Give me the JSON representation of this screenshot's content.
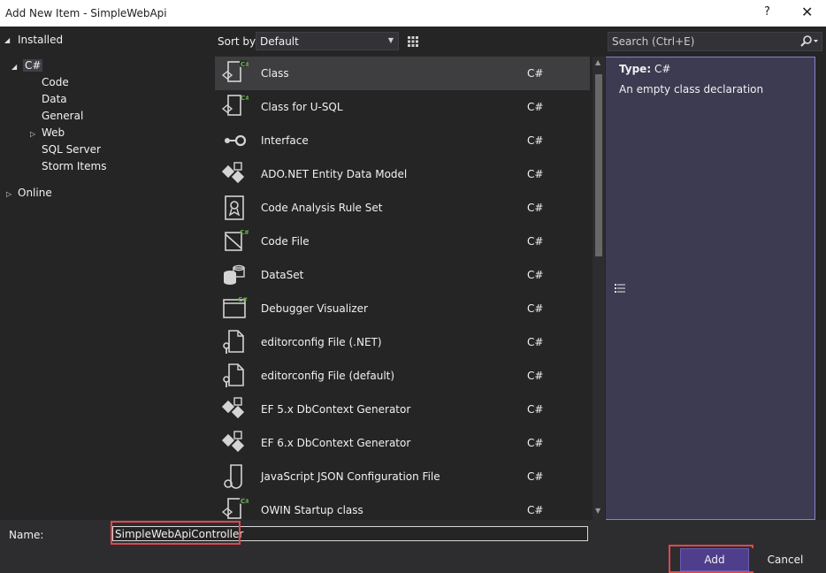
{
  "window": {
    "title": "Add New Item - SimpleWebApi",
    "help_label": "?",
    "close_label": "✕"
  },
  "toolbar": {
    "sort_label": "Sort by:",
    "sort_value": "Default",
    "search_placeholder": "Search (Ctrl+E)"
  },
  "tree": {
    "installed": "Installed",
    "csharp": "C#",
    "items": [
      "Code",
      "Data",
      "General",
      "Web",
      "SQL Server",
      "Storm Items"
    ],
    "online": "Online"
  },
  "templates": [
    {
      "name": "Class",
      "lang": "C#",
      "icon": "class-icon"
    },
    {
      "name": "Class for U-SQL",
      "lang": "C#",
      "icon": "class-usql-icon"
    },
    {
      "name": "Interface",
      "lang": "C#",
      "icon": "interface-icon"
    },
    {
      "name": "ADO.NET Entity Data Model",
      "lang": "C#",
      "icon": "entity-model-icon"
    },
    {
      "name": "Code Analysis Rule Set",
      "lang": "C#",
      "icon": "rule-set-icon"
    },
    {
      "name": "Code File",
      "lang": "C#",
      "icon": "code-file-icon"
    },
    {
      "name": "DataSet",
      "lang": "C#",
      "icon": "dataset-icon"
    },
    {
      "name": "Debugger Visualizer",
      "lang": "C#",
      "icon": "debugger-visualizer-icon"
    },
    {
      "name": "editorconfig File (.NET)",
      "lang": "C#",
      "icon": "editorconfig-icon"
    },
    {
      "name": "editorconfig File (default)",
      "lang": "C#",
      "icon": "editorconfig-icon"
    },
    {
      "name": "EF 5.x DbContext Generator",
      "lang": "C#",
      "icon": "ef-generator-icon"
    },
    {
      "name": "EF 6.x DbContext Generator",
      "lang": "C#",
      "icon": "ef-generator-icon"
    },
    {
      "name": "JavaScript JSON Configuration File",
      "lang": "C#",
      "icon": "json-config-icon"
    },
    {
      "name": "OWIN Startup class",
      "lang": "C#",
      "icon": "class-icon"
    }
  ],
  "details": {
    "type_label": "Type:",
    "type_value": "C#",
    "description": "An empty class declaration"
  },
  "footer": {
    "name_label": "Name:",
    "name_value": "SimpleWebApiController",
    "add_label": "Add",
    "cancel_label": "Cancel"
  },
  "colors": {
    "accent": "#4f3e8c",
    "highlight": "#e0474c",
    "csharp_badge": "#68b04e"
  }
}
